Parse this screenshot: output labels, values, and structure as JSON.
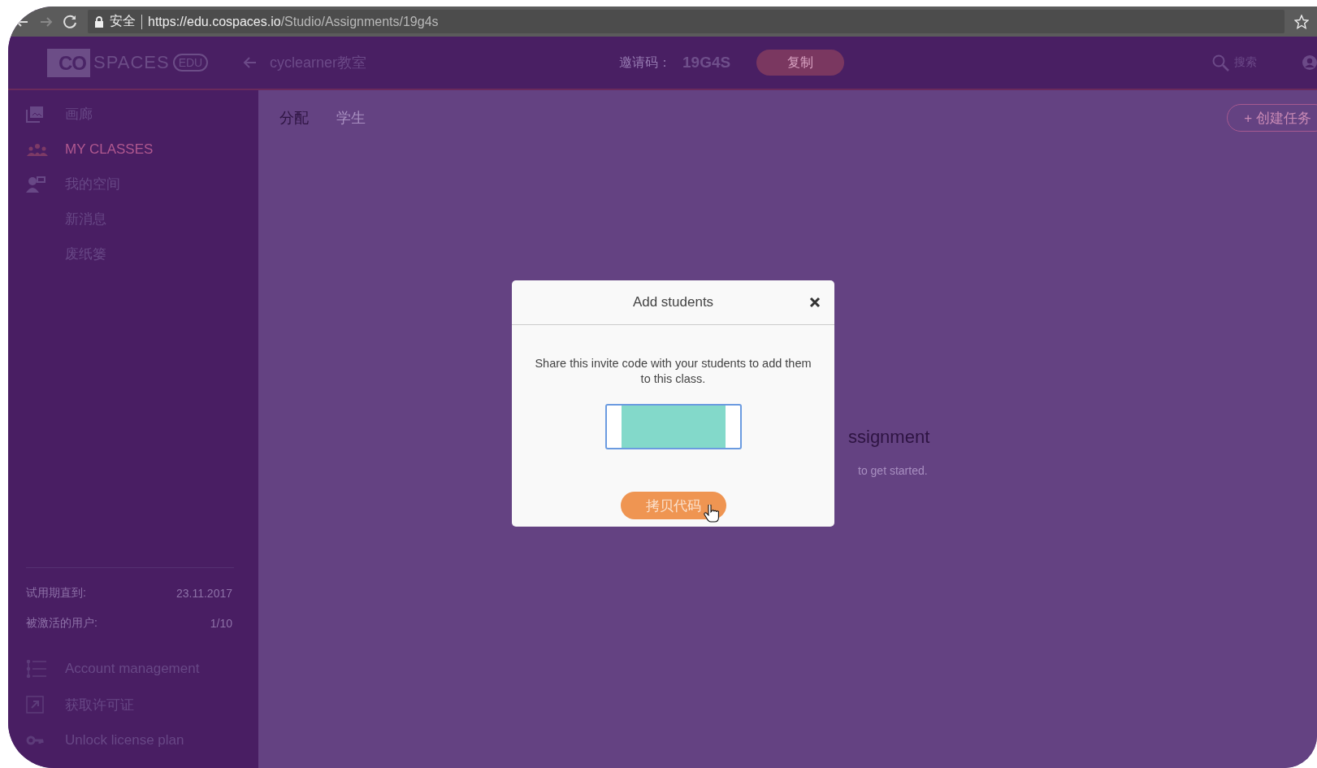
{
  "browser": {
    "secure_label": "安全",
    "url_host": "https://edu.cospaces.io",
    "url_path": "/Studio/Assignments/19g4s"
  },
  "header": {
    "logo": {
      "mark": "CO",
      "word": "SPACES",
      "badge": "EDU"
    },
    "class_name": "cyclearner教室",
    "invite_label": "邀请码：",
    "invite_code": "19G4S",
    "copy_button": "复制",
    "search_label": "搜索"
  },
  "sidebar": {
    "items": [
      {
        "label": "画廊",
        "selected": false
      },
      {
        "label": "MY CLASSES",
        "selected": true
      },
      {
        "label": "我的空间",
        "selected": false
      },
      {
        "label": "新消息",
        "selected": false
      },
      {
        "label": "废纸篓",
        "selected": false
      }
    ],
    "info": [
      {
        "label": "试用期直到:",
        "value": "23.11.2017"
      },
      {
        "label": "被激活的用户:",
        "value": "1/10"
      }
    ],
    "links": [
      {
        "label": "Account management"
      },
      {
        "label": "获取许可证"
      },
      {
        "label": "Unlock license plan"
      }
    ]
  },
  "tabs": [
    {
      "label": "分配",
      "selected": true
    },
    {
      "label": "学生",
      "selected": false
    }
  ],
  "create_button": "+ 创建任务",
  "empty_state": {
    "title": "ssignment",
    "hint": "to get started."
  },
  "modal": {
    "title": "Add students",
    "message": "Share this invite code with your students to add them to this class.",
    "copy_button": "拷贝代码"
  }
}
